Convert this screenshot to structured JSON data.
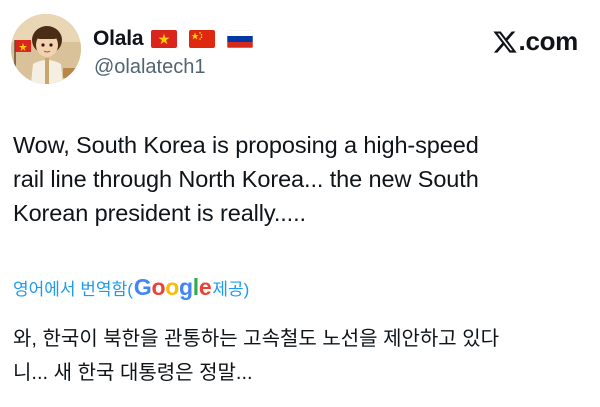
{
  "tweet": {
    "display_name": "Olala",
    "handle": "@olalatech1",
    "flags": [
      "vietnam-flag",
      "china-flag",
      "russia-flag"
    ],
    "text_lines": [
      "Wow, South Korea is proposing a high-speed",
      "rail line through North Korea... the new South",
      "Korean president is really....."
    ]
  },
  "brand": {
    "label": ".com",
    "icon": "x-logo-icon"
  },
  "translation": {
    "prefix": "영어에서 번역함(",
    "google_letters": [
      "G",
      "o",
      "o",
      "g",
      "l",
      "e"
    ],
    "suffix": " 제공)",
    "text_lines": [
      "와, 한국이 북한을 관통하는 고속철도 노선을 제안하고 있다",
      "니... 새 한국 대통령은 정말..."
    ]
  },
  "colors": {
    "link_blue": "#1d9bf0",
    "secondary_gray": "#536471",
    "text": "#0f1419",
    "google_blue": "#4285f4",
    "google_red": "#ea4335",
    "google_yellow": "#fbbc05",
    "google_green": "#34a853"
  }
}
